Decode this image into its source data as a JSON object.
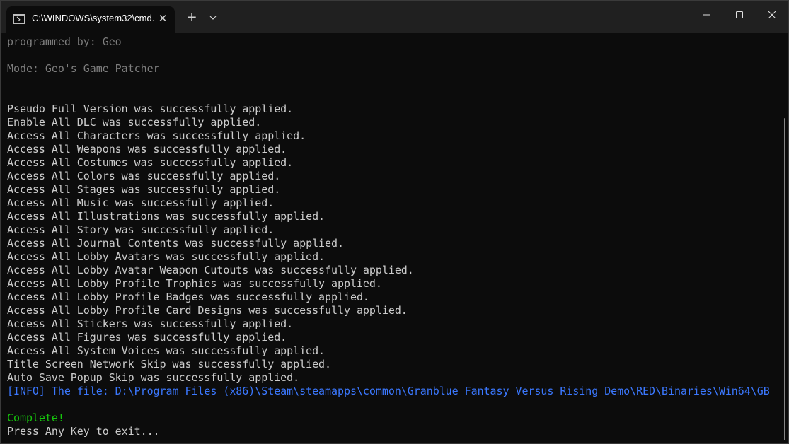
{
  "window": {
    "tab_title": "C:\\WINDOWS\\system32\\cmd.",
    "icons": {
      "tab_icon": "command-prompt-icon",
      "tab_close": "close-icon",
      "new_tab": "plus-icon",
      "dropdown": "chevron-down-icon",
      "minimize": "minimize-icon",
      "maximize": "maximize-icon",
      "close": "close-icon"
    },
    "tab_close_glyph": "✕",
    "new_tab_glyph": "+"
  },
  "console": {
    "header": {
      "programmed_by": "programmed by: Geo",
      "mode": "Mode: Geo's Game Patcher"
    },
    "patch_lines": [
      "Pseudo Full Version was successfully applied.",
      "Enable All DLC was successfully applied.",
      "Access All Characters was successfully applied.",
      "Access All Weapons was successfully applied.",
      "Access All Costumes was successfully applied.",
      "Access All Colors was successfully applied.",
      "Access All Stages was successfully applied.",
      "Access All Music was successfully applied.",
      "Access All Illustrations was successfully applied.",
      "Access All Story was successfully applied.",
      "Access All Journal Contents was successfully applied.",
      "Access All Lobby Avatars was successfully applied.",
      "Access All Lobby Avatar Weapon Cutouts was successfully applied.",
      "Access All Lobby Profile Trophies was successfully applied.",
      "Access All Lobby Profile Badges was successfully applied.",
      "Access All Lobby Profile Card Designs was successfully applied.",
      "Access All Stickers was successfully applied.",
      "Access All Figures was successfully applied.",
      "Access All System Voices was successfully applied.",
      "Title Screen Network Skip was successfully applied.",
      "Auto Save Popup Skip was successfully applied."
    ],
    "info_line": "[INFO] The file: D:\\Program Files (x86)\\Steam\\steamapps\\common\\Granblue Fantasy Versus Rising Demo\\RED\\Binaries\\Win64\\GB",
    "complete": "Complete!",
    "prompt": "Press Any Key to exit..."
  },
  "colors": {
    "background": "#0c0c0c",
    "titlebar": "#202020",
    "text": "#cccccc",
    "dim_text": "#7e7e7e",
    "info": "#3b78ff",
    "success": "#16c60c"
  }
}
